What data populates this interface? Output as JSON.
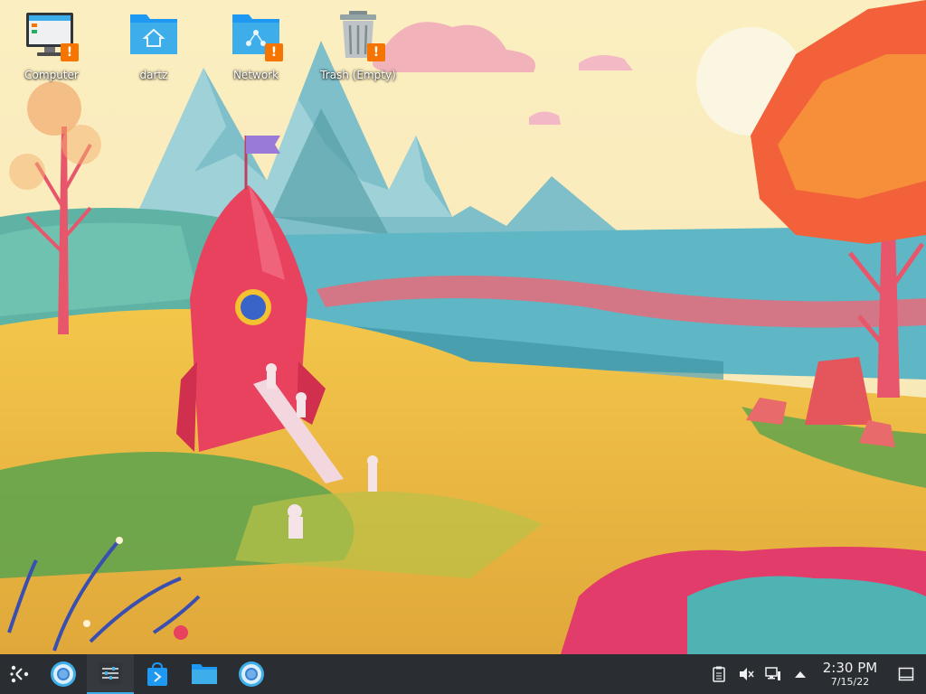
{
  "desktop": {
    "icons": [
      {
        "name": "computer",
        "label": "Computer",
        "icon": "computer-icon",
        "emblem": "!"
      },
      {
        "name": "home-folder",
        "label": "dartz",
        "icon": "home-folder-icon",
        "emblem": ""
      },
      {
        "name": "network",
        "label": "Network",
        "icon": "network-folder-icon",
        "emblem": "!"
      },
      {
        "name": "trash",
        "label": "Trash (Empty)",
        "icon": "trash-icon",
        "emblem": "!"
      }
    ]
  },
  "taskbar": {
    "launcher": {
      "icon": "kde-launcher-icon"
    },
    "tasks": [
      {
        "name": "chromium",
        "icon": "chromium-icon"
      },
      {
        "name": "system-settings",
        "icon": "settings-sliders-icon"
      },
      {
        "name": "discover",
        "icon": "discover-store-icon"
      },
      {
        "name": "file-manager",
        "icon": "folder-icon"
      },
      {
        "name": "chromium-2",
        "icon": "chromium-icon"
      }
    ],
    "tray": {
      "icons": [
        "clipboard-icon",
        "volume-muted-icon",
        "network-wired-icon",
        "expand-arrow-icon"
      ],
      "time": "2:30 PM",
      "date": "7/15/22"
    },
    "show_desktop_icon": "show-desktop-icon"
  },
  "colors": {
    "taskbar_bg": "#2a2e32",
    "accent": "#3daee9",
    "emblem": "#f67400",
    "folder_blue": "#3daee9"
  }
}
